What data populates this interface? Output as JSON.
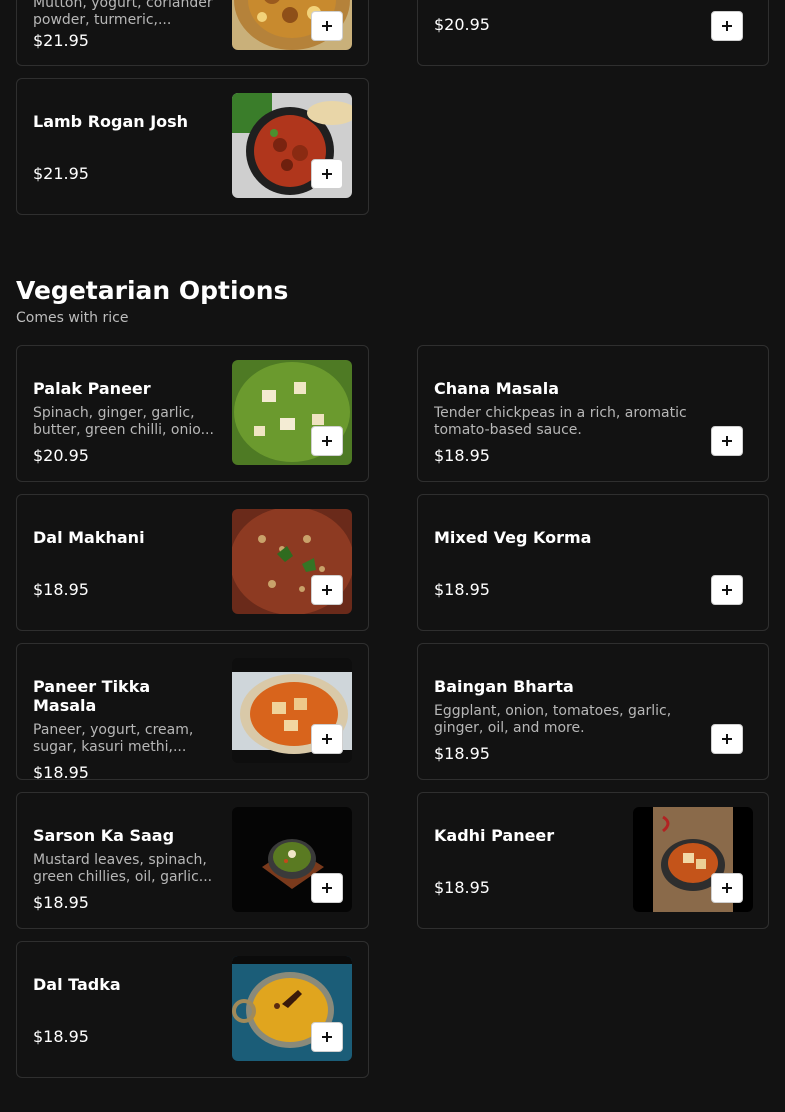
{
  "top_section": {
    "items": [
      {
        "desc": "Mutton, yogurt, coriander powder, turmeric,...",
        "price": "$21.95",
        "image": "mutton-curry"
      },
      {
        "price": "$20.95"
      },
      {
        "name": "Lamb Rogan Josh",
        "price": "$21.95",
        "image": "lamb-rogan-josh"
      }
    ]
  },
  "vegetarian": {
    "title": "Vegetarian Options",
    "subtitle": "Comes with rice",
    "items": [
      {
        "name": "Palak Paneer",
        "desc": "Spinach, ginger, garlic, butter, green chilli, onio...",
        "price": "$20.95",
        "image": "palak-paneer"
      },
      {
        "name": "Chana Masala",
        "desc": "Tender chickpeas in a rich, aromatic tomato-based sauce.",
        "price": "$18.95"
      },
      {
        "name": "Dal Makhani",
        "price": "$18.95",
        "image": "dal-makhani"
      },
      {
        "name": "Mixed Veg Korma",
        "price": "$18.95"
      },
      {
        "name": "Paneer Tikka Masala",
        "desc": "Paneer, yogurt, cream, sugar, kasuri methi,...",
        "price": "$18.95",
        "image": "paneer-tikka-masala"
      },
      {
        "name": "Baingan Bharta",
        "desc": "Eggplant, onion, tomatoes, garlic, ginger, oil, and more.",
        "price": "$18.95"
      },
      {
        "name": "Sarson Ka Saag",
        "desc": "Mustard leaves, spinach, green chillies, oil, garlic...",
        "price": "$18.95",
        "image": "sarson-ka-saag"
      },
      {
        "name": "Kadhi Paneer",
        "price": "$18.95",
        "image": "kadhi-paneer"
      },
      {
        "name": "Dal Tadka",
        "price": "$18.95",
        "image": "dal-tadka"
      }
    ]
  },
  "add_icon": "plus-icon"
}
